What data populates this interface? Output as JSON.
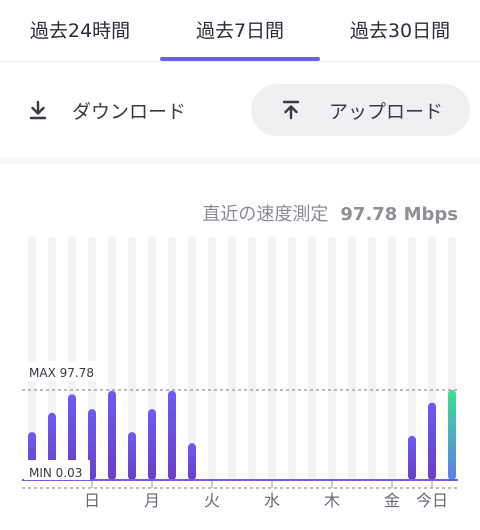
{
  "tabs": [
    {
      "label": "過去24時間",
      "active": false
    },
    {
      "label": "過去7日間",
      "active": true
    },
    {
      "label": "過去30日間",
      "active": false
    }
  ],
  "direction": {
    "download_label": "ダウンロード",
    "upload_label": "アップロード",
    "selected": "upload"
  },
  "latest": {
    "label": "直近の速度測定",
    "value": "97.78 Mbps"
  },
  "colors": {
    "accent": "#6a60e8",
    "bar_top": "#6a5cf3",
    "bar_bottom": "#6a3ec9",
    "current_top": "#3ee08f",
    "current_bottom": "#5a7cf0",
    "track": "#f3f3f5"
  },
  "chart_data": {
    "type": "bar",
    "unit": "Mbps",
    "max_label": "MAX 97.78",
    "min_label": "MIN 0.03",
    "max_value": 97.78,
    "min_value": 0.03,
    "x_labels": [
      "日",
      "月",
      "火",
      "水",
      "木",
      "金",
      "今日"
    ],
    "values": [
      52,
      73,
      93,
      77,
      97,
      52,
      77,
      97,
      40,
      0,
      0,
      0,
      0,
      0,
      0,
      0,
      0,
      0,
      0,
      48,
      84,
      97.78
    ],
    "highlight_last": true
  }
}
